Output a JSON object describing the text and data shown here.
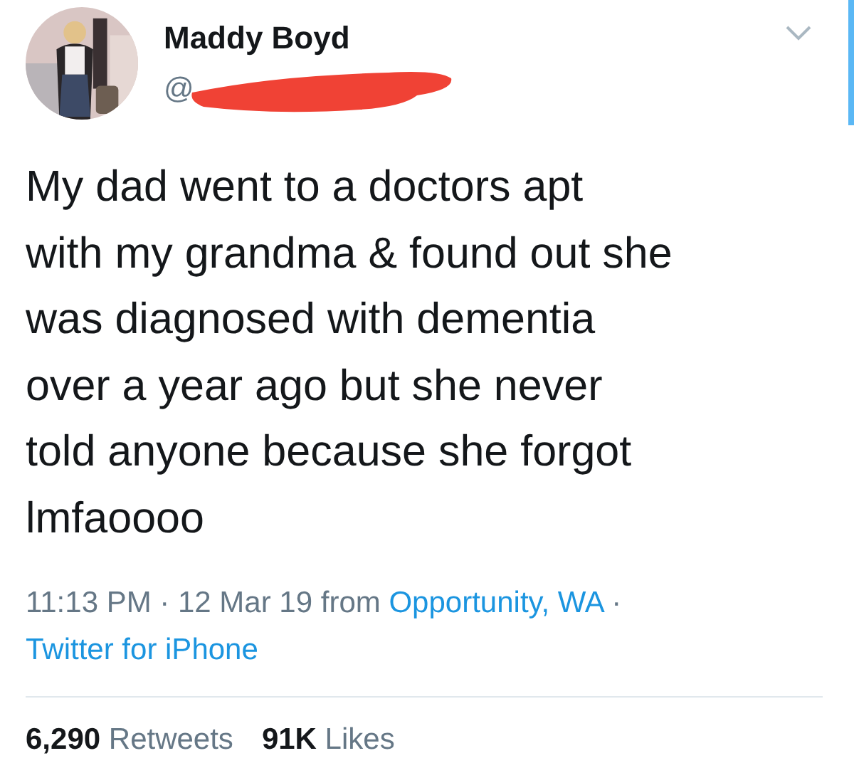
{
  "author": {
    "name": "Maddy Boyd",
    "handle": "@",
    "handle_redacted": true
  },
  "tweet": {
    "text_lines": [
      "My dad went to a doctors apt",
      "with my grandma & found out she",
      "was diagnosed with dementia",
      "over a year ago but she never",
      "told anyone because she forgot",
      "lmfaoooo"
    ]
  },
  "meta": {
    "time": "11:13 PM",
    "separator": "·",
    "date": "12 Mar 19",
    "from_label": "from",
    "location": "Opportunity, WA",
    "source": "Twitter for iPhone"
  },
  "stats": [
    {
      "count": "6,290",
      "label": "Retweets"
    },
    {
      "count": "91K",
      "label": "Likes"
    }
  ]
}
